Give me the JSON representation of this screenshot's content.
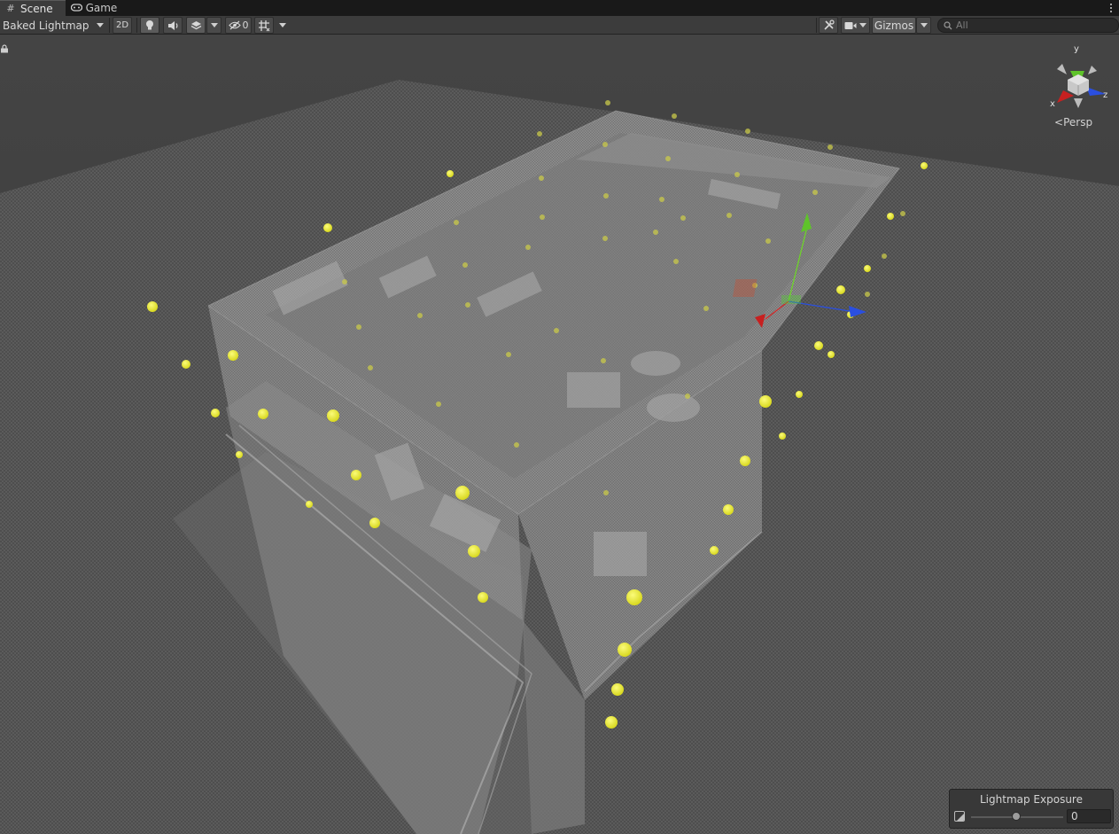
{
  "tabs": [
    {
      "label": "Scene",
      "icon": "grid-icon",
      "active": true
    },
    {
      "label": "Game",
      "icon": "gamepad-icon",
      "active": false
    }
  ],
  "toolbar": {
    "draw_mode": "Baked Lightmap",
    "mode_2d_label": "2D",
    "hidden_count": "0",
    "gizmos_label": "Gizmos"
  },
  "search": {
    "placeholder": "All"
  },
  "scene_gizmo": {
    "y_label": "y",
    "x_label": "x",
    "z_label": "z",
    "projection_label": "Persp"
  },
  "lightmap_exposure": {
    "title": "Lightmap Exposure",
    "value": "0"
  },
  "colors": {
    "background": "#3a3a3a",
    "toolbar": "#3c3c3c",
    "tabbar": "#191919",
    "light_probe": "#e6e62a",
    "axis_x": "#d12a2a",
    "axis_y": "#6fd42a",
    "axis_z": "#2a4fe0"
  }
}
